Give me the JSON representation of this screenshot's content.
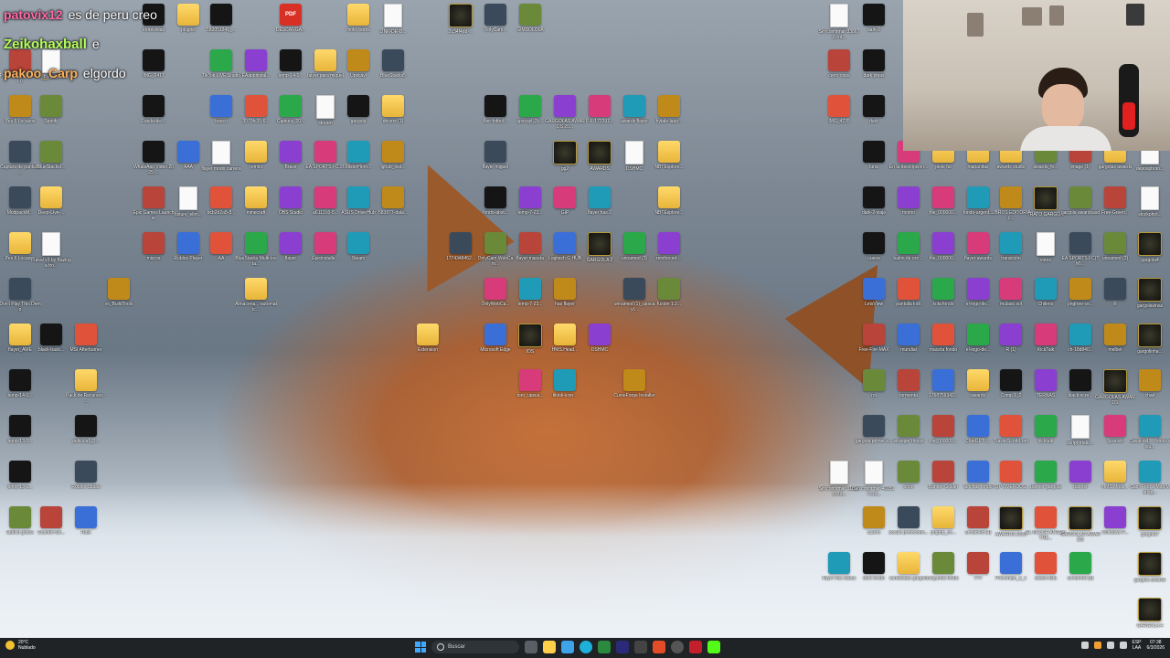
{
  "chat": [
    {
      "user": "patovix12",
      "message": "es de peru creo",
      "color": "#ff6aa8"
    },
    {
      "user": "Zeikohaxball",
      "message": "e",
      "color": "#b6ff5a"
    },
    {
      "user": "pakoo_Carp",
      "message": "elgordo",
      "color": "#ffb15a"
    }
  ],
  "desktop_icons": [
    {
      "label": "entrevistas",
      "kind": "dark",
      "icon": "app-icon"
    },
    {
      "label": "plugins",
      "kind": "folder",
      "icon": "folder-icon"
    },
    {
      "label": "582051241_...",
      "kind": "dark",
      "icon": "image-icon"
    },
    {
      "label": "DESCARGA...",
      "kind": "pdf",
      "icon": "pdf-icon"
    },
    {
      "label": "mofo cstrtrs",
      "kind": "folder",
      "icon": "folder-icon"
    },
    {
      "label": "LINK-DE-D...",
      "kind": "file",
      "icon": "file-icon"
    },
    {
      "label": "2c34f4dd-...",
      "kind": "gold",
      "icon": "image-icon"
    },
    {
      "label": "OnlyCam...",
      "kind": "app",
      "icon": "app-icon"
    },
    {
      "label": "GIMSOLOLA",
      "kind": "app",
      "icon": "monkey-icon"
    },
    {
      "label": "Pro Evolution Soccer 6",
      "kind": "app",
      "icon": "game-icon"
    },
    {
      "label": "Fortnite",
      "kind": "file",
      "icon": "file-icon"
    },
    {
      "label": "IMG_2417",
      "kind": "dark",
      "icon": "image-icon"
    },
    {
      "label": "TikTok LIVE Studio",
      "kind": "app",
      "icon": "tiktok-icon"
    },
    {
      "label": "EAappinstal...",
      "kind": "app",
      "icon": "ea-icon"
    },
    {
      "label": "temp-14-1...",
      "kind": "dark",
      "icon": "image-icon"
    },
    {
      "label": "falyer para miguel",
      "kind": "folder",
      "icon": "folder-icon"
    },
    {
      "label": "Upscayl",
      "kind": "app",
      "icon": "app-icon"
    },
    {
      "label": "BlueStacks5",
      "kind": "app",
      "icon": "bluestacks-icon"
    },
    {
      "label": "Spotify",
      "kind": "app",
      "icon": "spotify-icon"
    },
    {
      "label": "Rueda-de-...",
      "kind": "dark",
      "icon": "image-icon"
    },
    {
      "label": "banco",
      "kind": "app",
      "icon": "app-icon"
    },
    {
      "label": "3970fc35-6...",
      "kind": "app",
      "icon": "app-icon"
    },
    {
      "label": "Captura_20...",
      "kind": "app",
      "icon": "app-icon"
    },
    {
      "label": "stream",
      "kind": "file",
      "icon": "file-icon"
    },
    {
      "label": "gargola",
      "kind": "dark",
      "icon": "image-icon"
    },
    {
      "label": "drivers (1)",
      "kind": "folder",
      "icon": "folder-icon"
    },
    {
      "label": "Pes 6 Locasos",
      "kind": "app",
      "icon": "app-icon"
    },
    {
      "label": "Captura de pantalla ...",
      "kind": "app",
      "icon": "app-icon"
    },
    {
      "label": "BlueStacksI...",
      "kind": "app",
      "icon": "bluestacks-icon"
    },
    {
      "label": "WhatsApp Video 2025-...",
      "kind": "dark",
      "icon": "video-icon"
    },
    {
      "label": "AAA",
      "kind": "app",
      "icon": "app-icon"
    },
    {
      "label": "flayer modo carrera",
      "kind": "file",
      "icon": "file-icon"
    },
    {
      "label": "remini",
      "kind": "folder",
      "icon": "folder-icon"
    },
    {
      "label": "Brave",
      "kind": "app",
      "icon": "brave-icon"
    },
    {
      "label": "EA SPORTS FC 26",
      "kind": "app",
      "icon": "app-icon"
    },
    {
      "label": "MisterHorn...",
      "kind": "app",
      "icon": "app-icon"
    },
    {
      "label": "lghub_inst...",
      "kind": "app",
      "icon": "logitech-icon"
    },
    {
      "label": "ModpackM...",
      "kind": "app",
      "icon": "app-icon"
    },
    {
      "label": "Deep-Live-...",
      "kind": "folder",
      "icon": "folder-icon"
    },
    {
      "label": "Epic Games Launcher",
      "kind": "app",
      "icon": "epic-icon"
    },
    {
      "label": "fixture_elim...",
      "kind": "file",
      "icon": "file-icon"
    },
    {
      "label": "bcb2d2a5-8...",
      "kind": "app",
      "icon": "app-icon"
    },
    {
      "label": "minecraft",
      "kind": "folder",
      "icon": "folder-icon"
    },
    {
      "label": "OBS Studio",
      "kind": "app",
      "icon": "obs-icon"
    },
    {
      "label": "a611310-5...",
      "kind": "app",
      "icon": "app-icon"
    },
    {
      "label": "ASUS DriverHub",
      "kind": "app",
      "icon": "app-icon"
    },
    {
      "label": "583877-dala...",
      "kind": "app",
      "icon": "nvidia-icon"
    },
    {
      "label": "Pes 6 Locasos",
      "kind": "folder",
      "icon": "folder-icon"
    },
    {
      "label": "Futsal v3 by Bazinga fro...",
      "kind": "file",
      "icon": "file-icon"
    },
    {
      "label": "micros",
      "kind": "app",
      "icon": "app-icon"
    },
    {
      "label": "Roblox Player",
      "kind": "app",
      "icon": "roblox-icon"
    },
    {
      "label": "AA",
      "kind": "app",
      "icon": "app-icon"
    },
    {
      "label": "BlueStacks Multi-Insta...",
      "kind": "app",
      "icon": "bluestacks-icon"
    },
    {
      "label": "flayer",
      "kind": "app",
      "icon": "ae-icon"
    },
    {
      "label": "Epicinstalle...",
      "kind": "app",
      "icon": "app-icon"
    },
    {
      "label": "Steam",
      "kind": "app",
      "icon": "steam-icon"
    },
    {
      "label": "vs_BuildTools",
      "kind": "app",
      "icon": "vs-icon"
    },
    {
      "label": "Don't Play This Demo",
      "kind": "app",
      "icon": "game-icon"
    },
    {
      "label": "Almacena... automatic...",
      "kind": "folder",
      "icon": "folder-icon"
    },
    {
      "label": "flayer_AME",
      "kind": "folder",
      "icon": "folder-icon"
    },
    {
      "label": "black-back...",
      "kind": "dark",
      "icon": "image-icon"
    },
    {
      "label": "MSI Afterburner",
      "kind": "app",
      "icon": "app-icon"
    },
    {
      "label": "temp-14-1...",
      "kind": "dark",
      "icon": "image-icon"
    },
    {
      "label": "Pack de Recursos - ...",
      "kind": "folder",
      "icon": "folder-icon"
    },
    {
      "label": "temp-13-1...",
      "kind": "dark",
      "icon": "image-icon"
    },
    {
      "label": "pelicula1_3...",
      "kind": "dark",
      "icon": "image-icon"
    },
    {
      "label": "temp-13-1...",
      "kind": "dark",
      "icon": "image-icon"
    },
    {
      "label": "Roblox Studio",
      "kind": "app",
      "icon": "roblox-icon"
    },
    {
      "label": "ladrillo grises",
      "kind": "app",
      "icon": "image-icon"
    },
    {
      "label": "Counter-Str...",
      "kind": "app",
      "icon": "game-icon"
    },
    {
      "label": "Rust",
      "kind": "app",
      "icon": "game-icon"
    },
    {
      "label": "flier-fotbol...",
      "kind": "dark",
      "icon": "image-icon"
    },
    {
      "label": "upscayl_2c...",
      "kind": "app",
      "icon": "app-icon"
    },
    {
      "label": "GARGOLAS AWARDS 20...",
      "kind": "app",
      "icon": "app-icon"
    },
    {
      "label": "F-F-172391...",
      "kind": "app",
      "icon": "app-icon"
    },
    {
      "label": "awards flayer",
      "kind": "app",
      "icon": "app-icon"
    },
    {
      "label": "hytale-laun...",
      "kind": "app",
      "icon": "app-icon"
    },
    {
      "label": "flayer miguel",
      "kind": "app",
      "icon": "image-icon"
    },
    {
      "label": "gg2",
      "kind": "gold",
      "icon": "image-icon"
    },
    {
      "label": "AWARDS",
      "kind": "gold",
      "icon": "image-icon"
    },
    {
      "label": "DSHMC",
      "kind": "file",
      "icon": "json-icon"
    },
    {
      "label": "NBTExplore...",
      "kind": "folder",
      "icon": "folder-icon"
    },
    {
      "label": "fondo-abst...",
      "kind": "dark",
      "icon": "image-icon"
    },
    {
      "label": "temp-7-23...",
      "kind": "app",
      "icon": "image-icon"
    },
    {
      "label": "GIP",
      "kind": "app",
      "icon": "image-icon"
    },
    {
      "label": "flayer has 2",
      "kind": "app",
      "icon": "image-icon"
    },
    {
      "label": "NBTExplore...",
      "kind": "folder",
      "icon": "folder-icon"
    },
    {
      "label": "1774348452...",
      "kind": "app",
      "icon": "app-icon"
    },
    {
      "label": "OnlyCam WebCam...",
      "kind": "app",
      "icon": "app-icon"
    },
    {
      "label": "flayer maceta",
      "kind": "app",
      "icon": "image-icon"
    },
    {
      "label": "Logitech G HUB",
      "kind": "app",
      "icon": "logitech-icon"
    },
    {
      "label": "GARGOLA 2",
      "kind": "gold",
      "icon": "image-icon"
    },
    {
      "label": "unnamed (3)",
      "kind": "app",
      "icon": "image-icon"
    },
    {
      "label": "reinforced-...",
      "kind": "app",
      "icon": "java-icon"
    },
    {
      "label": "OnlyWebCa...",
      "kind": "app",
      "icon": "app-icon"
    },
    {
      "label": "temp-7-23...",
      "kind": "app",
      "icon": "image-icon"
    },
    {
      "label": "has flayer",
      "kind": "app",
      "icon": "image-icon"
    },
    {
      "label": "unnamed (1)_upscayl...",
      "kind": "app",
      "icon": "image-icon"
    },
    {
      "label": "fusion-1.2...",
      "kind": "app",
      "icon": "java-icon"
    },
    {
      "label": "Extension",
      "kind": "folder",
      "icon": "folder-icon"
    },
    {
      "label": "Microsoft Edge",
      "kind": "app",
      "icon": "edge-icon"
    },
    {
      "label": "IDS",
      "kind": "gold",
      "icon": "image-icon"
    },
    {
      "label": "HMS.Head...",
      "kind": "folder",
      "icon": "folder-icon"
    },
    {
      "label": "DSHMC",
      "kind": "app",
      "icon": "app-icon"
    },
    {
      "label": "toro_upsca...",
      "kind": "app",
      "icon": "image-icon"
    },
    {
      "label": "tiktok-icon...",
      "kind": "app",
      "icon": "tiktok-icon"
    },
    {
      "label": "CurseForge Installer",
      "kind": "app",
      "icon": "curseforge-icon"
    },
    {
      "label": "Sin confirmar 338672.crd...",
      "kind": "file",
      "icon": "file-icon"
    },
    {
      "label": "dark-2",
      "kind": "dark",
      "icon": "image-icon"
    },
    {
      "label": "cerro copa",
      "kind": "app",
      "icon": "image-icon"
    },
    {
      "label": "dark jonas",
      "kind": "dark",
      "icon": "image-icon"
    },
    {
      "label": "IMG_4235",
      "kind": "app",
      "icon": "video-icon"
    },
    {
      "label": "dark",
      "kind": "dark",
      "icon": "image-icon"
    },
    {
      "label": "luna",
      "kind": "dark",
      "icon": "image-icon"
    },
    {
      "label": "En la descripcion...",
      "kind": "app",
      "icon": "image-icon"
    },
    {
      "label": "piele fut",
      "kind": "folder",
      "icon": "folder-icon"
    },
    {
      "label": "mapanitas",
      "kind": "folder",
      "icon": "folder-icon"
    },
    {
      "label": "awards studio",
      "kind": "folder",
      "icon": "folder-icon"
    },
    {
      "label": "awards_fo...",
      "kind": "app",
      "icon": "image-icon"
    },
    {
      "label": "image (1)",
      "kind": "app",
      "icon": "image-icon"
    },
    {
      "label": "gargolas awards",
      "kind": "folder",
      "icon": "folder-icon"
    },
    {
      "label": "deposphoto...",
      "kind": "file",
      "icon": "image-icon"
    },
    {
      "label": "dark-2-viaje",
      "kind": "dark",
      "icon": "image-icon"
    },
    {
      "label": "momo",
      "kind": "app",
      "icon": "image-icon"
    },
    {
      "label": "file_000000...",
      "kind": "app",
      "icon": "image-icon"
    },
    {
      "label": "fondo-argent...",
      "kind": "app",
      "icon": "image-icon"
    },
    {
      "label": "LIBROS EDITORIAL...",
      "kind": "app",
      "icon": "image-icon"
    },
    {
      "label": "TRATO GARGO...",
      "kind": "gold",
      "icon": "image-icon"
    },
    {
      "label": "gargola awardsasd",
      "kind": "app",
      "icon": "image-icon"
    },
    {
      "label": "Free-Green...",
      "kind": "app",
      "icon": "image-icon"
    },
    {
      "label": "stockphot...",
      "kind": "file",
      "icon": "image-icon"
    },
    {
      "label": "cueva",
      "kind": "dark",
      "icon": "image-icon"
    },
    {
      "label": "balón de oro ...",
      "kind": "app",
      "icon": "image-icon"
    },
    {
      "label": "file_000000...",
      "kind": "app",
      "icon": "image-icon"
    },
    {
      "label": "flayer awards",
      "kind": "app",
      "icon": "image-icon"
    },
    {
      "label": "transición",
      "kind": "app",
      "icon": "image-icon"
    },
    {
      "label": "votos",
      "kind": "file",
      "icon": "file-icon"
    },
    {
      "label": "EA SPORTS FC(TM)...",
      "kind": "app",
      "icon": "app-icon"
    },
    {
      "label": "unnamed (2)",
      "kind": "app",
      "icon": "image-icon"
    },
    {
      "label": "gargola4",
      "kind": "gold",
      "icon": "image-icon"
    },
    {
      "label": "LetsView",
      "kind": "app",
      "icon": "app-icon"
    },
    {
      "label": "pantalla kick",
      "kind": "app",
      "icon": "image-icon"
    },
    {
      "label": "kola fondo",
      "kind": "app",
      "icon": "image-icon"
    },
    {
      "label": "el-logo-de...",
      "kind": "app",
      "icon": "image-icon"
    },
    {
      "label": "mulaso sol",
      "kind": "app",
      "icon": "image-icon"
    },
    {
      "label": "Chileno",
      "kind": "app",
      "icon": "image-icon"
    },
    {
      "label": "pngtree-ce...",
      "kind": "app",
      "icon": "image-icon"
    },
    {
      "label": "R",
      "kind": "app",
      "icon": "image-icon"
    },
    {
      "label": "gargolavinas",
      "kind": "gold",
      "icon": "image-icon"
    },
    {
      "label": "Free-Fire-MAX",
      "kind": "app",
      "icon": "game-icon"
    },
    {
      "label": "mundial",
      "kind": "app",
      "icon": "image-icon"
    },
    {
      "label": "maceta fondo",
      "kind": "app",
      "icon": "image-icon"
    },
    {
      "label": "el-logo-de...",
      "kind": "app",
      "icon": "image-icon"
    },
    {
      "label": "R (1)",
      "kind": "app",
      "icon": "image-icon"
    },
    {
      "label": "KickTalk",
      "kind": "app",
      "icon": "kick-icon"
    },
    {
      "label": "ch-18d840...",
      "kind": "app",
      "icon": "image-icon"
    },
    {
      "label": "melbet",
      "kind": "app",
      "icon": "image-icon"
    },
    {
      "label": "gargolinha...",
      "kind": "gold",
      "icon": "image-icon"
    },
    {
      "label": "rol",
      "kind": "app",
      "icon": "image-icon"
    },
    {
      "label": "tormenta",
      "kind": "app",
      "icon": "image-icon"
    },
    {
      "label": "1768759342...",
      "kind": "app",
      "icon": "image-icon"
    },
    {
      "label": "awards",
      "kind": "folder",
      "icon": "folder-icon"
    },
    {
      "label": "Comp 1_2",
      "kind": "dark",
      "icon": "image-icon"
    },
    {
      "label": "TERNAS",
      "kind": "app",
      "icon": "ae-icon"
    },
    {
      "label": "black-scre...",
      "kind": "dark",
      "icon": "image-icon"
    },
    {
      "label": "GARGOLAS AWARDS",
      "kind": "gold",
      "icon": "image-icon"
    },
    {
      "label": "chad",
      "kind": "app",
      "icon": "image-icon"
    },
    {
      "label": "gargola primer e...",
      "kind": "app",
      "icon": "image-icon"
    },
    {
      "label": "stranger things",
      "kind": "app",
      "icon": "image-icon"
    },
    {
      "label": "file_000000...",
      "kind": "app",
      "icon": "image-icon"
    },
    {
      "label": "ChatGPT I...",
      "kind": "app",
      "icon": "image-icon"
    },
    {
      "label": "Travis-Scott-Lord",
      "kind": "app",
      "icon": "image-icon"
    },
    {
      "label": "kicktalk",
      "kind": "app",
      "icon": "kick-icon"
    },
    {
      "label": "script-matic...",
      "kind": "file",
      "icon": "file-icon"
    },
    {
      "label": "Spanish",
      "kind": "app",
      "icon": "image-icon"
    },
    {
      "label": "Canal-vid ... fondo-Volu...",
      "kind": "app",
      "icon": "video-icon"
    },
    {
      "label": "Sin confirmar 318231.crd...",
      "kind": "file",
      "icon": "file-icon"
    },
    {
      "label": "Sin confirmar 401517.crd...",
      "kind": "file",
      "icon": "file-icon"
    },
    {
      "label": "orion",
      "kind": "app",
      "icon": "image-icon"
    },
    {
      "label": "Banner Gouler",
      "kind": "app",
      "icon": "image-icon"
    },
    {
      "label": "lanchas fondo",
      "kind": "app",
      "icon": "image-icon"
    },
    {
      "label": "TOP OVERDOS...",
      "kind": "app",
      "icon": "image-icon"
    },
    {
      "label": "banner gargola",
      "kind": "app",
      "icon": "image-icon"
    },
    {
      "label": "banner",
      "kind": "app",
      "icon": "image-icon"
    },
    {
      "label": "HMS.Mods...",
      "kind": "folder",
      "icon": "folder-icon"
    },
    {
      "label": "Can't Find a Mod Manag...",
      "kind": "app",
      "icon": "image-icon"
    },
    {
      "label": "cuerro",
      "kind": "app",
      "icon": "image-icon"
    },
    {
      "label": "zocalo promoción...",
      "kind": "app",
      "icon": "image-icon"
    },
    {
      "label": "pngtop_ch...",
      "kind": "folder",
      "icon": "folder-icon"
    },
    {
      "label": "unnamed (4)",
      "kind": "app",
      "icon": "image-icon"
    },
    {
      "label": "AWARDS 2025",
      "kind": "gold",
      "icon": "image-icon"
    },
    {
      "label": "EL MEJOR ANCESTRE...",
      "kind": "app",
      "icon": "image-icon"
    },
    {
      "label": "GARGOLAS AWARDS",
      "kind": "gold",
      "icon": "image-icon"
    },
    {
      "label": "Windows P...",
      "kind": "app",
      "icon": "image-icon"
    },
    {
      "label": "gargola7",
      "kind": "gold",
      "icon": "image-icon"
    },
    {
      "label": "flayer has status",
      "kind": "app",
      "icon": "image-icon"
    },
    {
      "label": "dark fondo",
      "kind": "dark",
      "icon": "image-icon"
    },
    {
      "label": "candidatas gargola",
      "kind": "folder",
      "icon": "folder-icon"
    },
    {
      "label": "segunda fondo",
      "kind": "app",
      "icon": "image-icon"
    },
    {
      "label": "TYT",
      "kind": "app",
      "icon": "image-icon"
    },
    {
      "label": "Precompo_2_1",
      "kind": "app",
      "icon": "image-icon"
    },
    {
      "label": "stadio-lista",
      "kind": "app",
      "icon": "image-icon"
    },
    {
      "label": "unnamed (3)",
      "kind": "app",
      "icon": "image-icon"
    },
    {
      "label": "gargola awards",
      "kind": "gold",
      "icon": "image-icon"
    },
    {
      "label": "GARGOLA 4",
      "kind": "gold",
      "icon": "image-icon"
    }
  ],
  "taskbar": {
    "weather_temp": "20°C",
    "weather_desc": "Nublado",
    "search_placeholder": "Buscar",
    "lang_top": "ESP",
    "lang_bottom": "LAA",
    "time": "07:38",
    "date": "6/3/2026"
  },
  "colors": {
    "taskbar_bg": "#1f2326",
    "windows_blue": "#3fa9ff",
    "folder_yellow": "#ffd96a"
  }
}
